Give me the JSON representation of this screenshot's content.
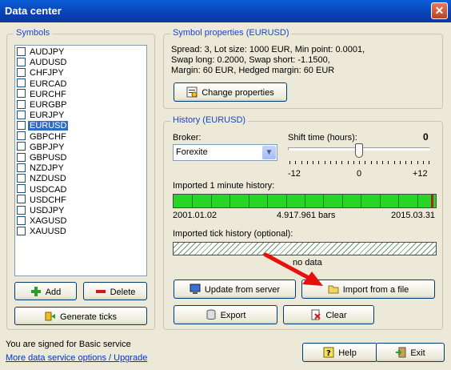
{
  "window": {
    "title": "Data center",
    "close_label": "✕"
  },
  "symbols": {
    "legend": "Symbols",
    "items": [
      "AUDJPY",
      "AUDUSD",
      "CHFJPY",
      "EURCAD",
      "EURCHF",
      "EURGBP",
      "EURJPY",
      "EURUSD",
      "GBPCHF",
      "GBPJPY",
      "GBPUSD",
      "NZDJPY",
      "NZDUSD",
      "USDCAD",
      "USDCHF",
      "USDJPY",
      "XAGUSD",
      "XAUUSD"
    ],
    "selected_index": 7,
    "add_label": "Add",
    "delete_label": "Delete",
    "generate_label": "Generate ticks"
  },
  "properties": {
    "legend": "Symbol properties (EURUSD)",
    "line1": "Spread: 3, Lot size: 1000 EUR, Min point: 0.0001,",
    "line2": "Swap long: 0.2000, Swap short: -1.1500,",
    "line3": "Margin: 60 EUR, Hedged margin: 60 EUR",
    "change_label": "Change properties"
  },
  "history": {
    "legend": "History (EURUSD)",
    "broker_label": "Broker:",
    "broker_value": "Forexite",
    "shift_label": "Shift time (hours):",
    "shift_value": "0",
    "shift_min": "-12",
    "shift_mid": "0",
    "shift_max": "+12",
    "shift_level": 0.5,
    "imported_label": "Imported 1 minute history:",
    "start_date": "2001.01.02",
    "bars": "4.917.961 bars",
    "end_date": "2015.03.31",
    "tick_label": "Imported tick history (optional):",
    "tick_status": "no data",
    "update_label": "Update from server",
    "import_label": "Import from a file",
    "export_label": "Export",
    "clear_label": "Clear"
  },
  "footer": {
    "signed_text": "You are signed for Basic service",
    "link_text": "More data service options / Upgrade",
    "help_label": "Help",
    "exit_label": "Exit"
  },
  "colors": {
    "accent": "#1a45c8",
    "selection": "#316ac5",
    "history_fill": "#27d527",
    "arrow": "#e8100c"
  }
}
